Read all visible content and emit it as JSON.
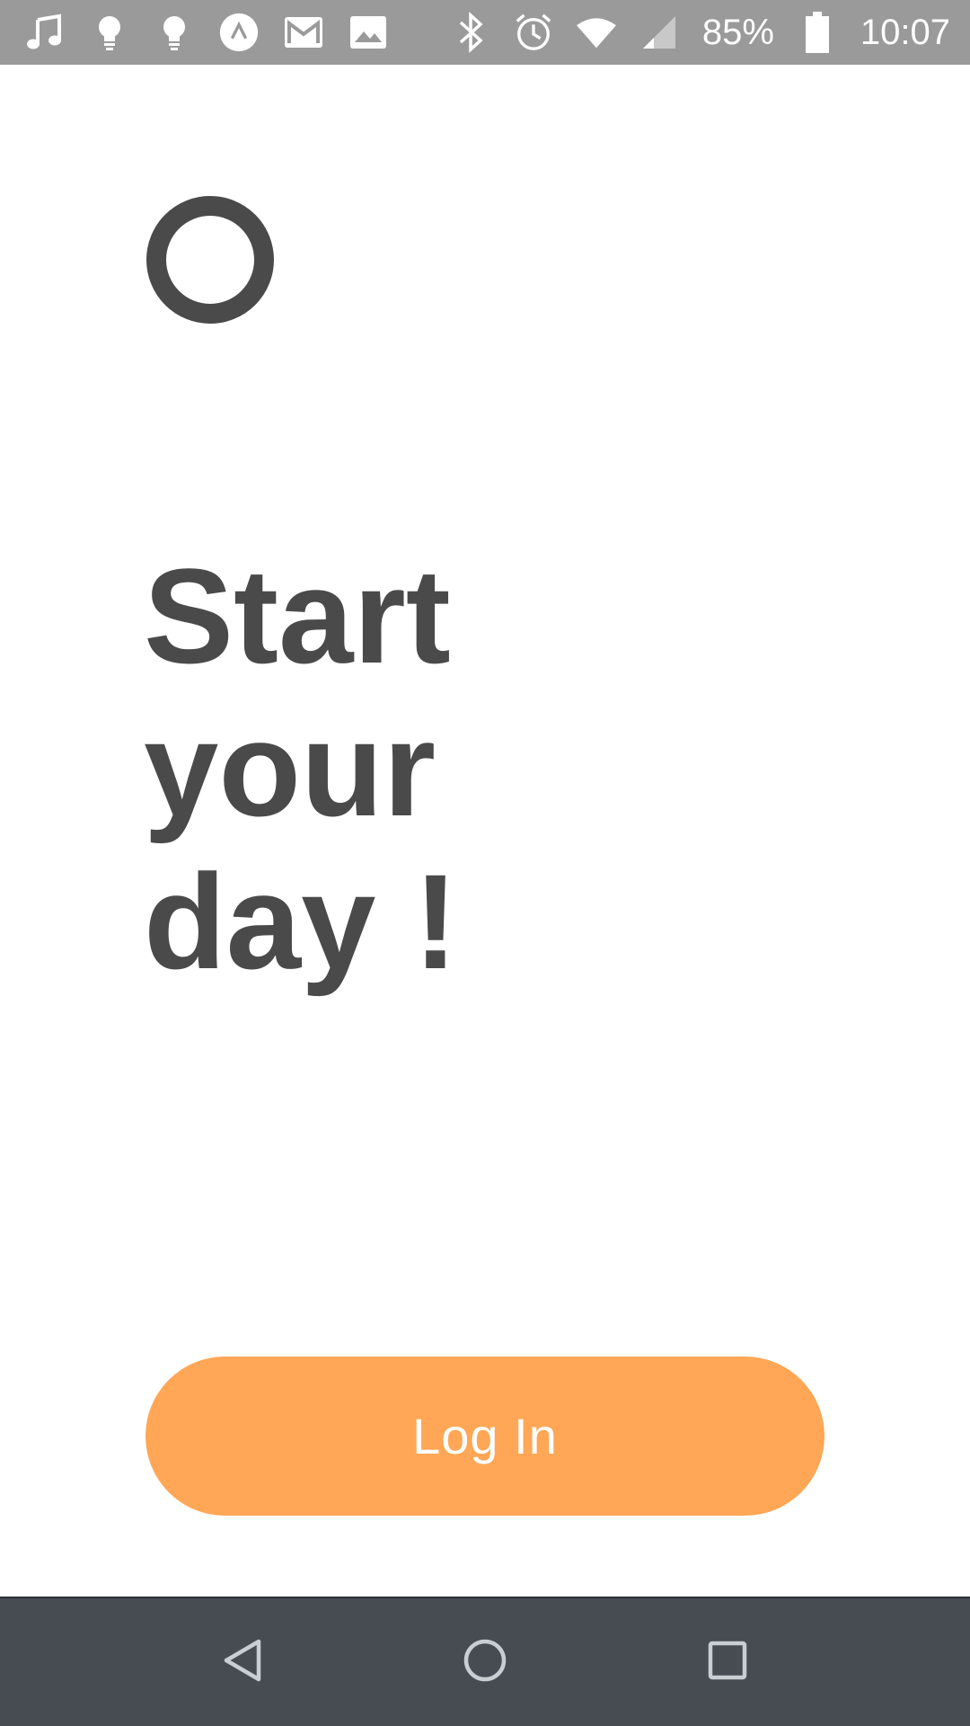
{
  "status_bar": {
    "left_icons": [
      "music-note-icon",
      "lightbulb-icon",
      "lightbulb-icon",
      "caret-circle-icon",
      "gmail-icon",
      "image-icon"
    ],
    "right_icons": [
      "bluetooth-icon",
      "alarm-icon",
      "wifi-icon",
      "signal-icon",
      "battery-icon"
    ],
    "battery_text": "85%",
    "time": "10:07"
  },
  "logo": {
    "icon": "ring-logo-icon"
  },
  "headline": {
    "line1": "Start",
    "line2": "your",
    "line3": "day !"
  },
  "login_button": {
    "label": "Log In"
  },
  "nav_bar": {
    "back_icon": "back-triangle-icon",
    "home_icon": "home-circle-icon",
    "recents_icon": "recents-square-icon"
  },
  "colors": {
    "status_bar_bg": "#9a9a9a",
    "text_dark": "#4a4a4a",
    "accent_orange": "#ffa756",
    "nav_bar_bg": "#464c52"
  }
}
